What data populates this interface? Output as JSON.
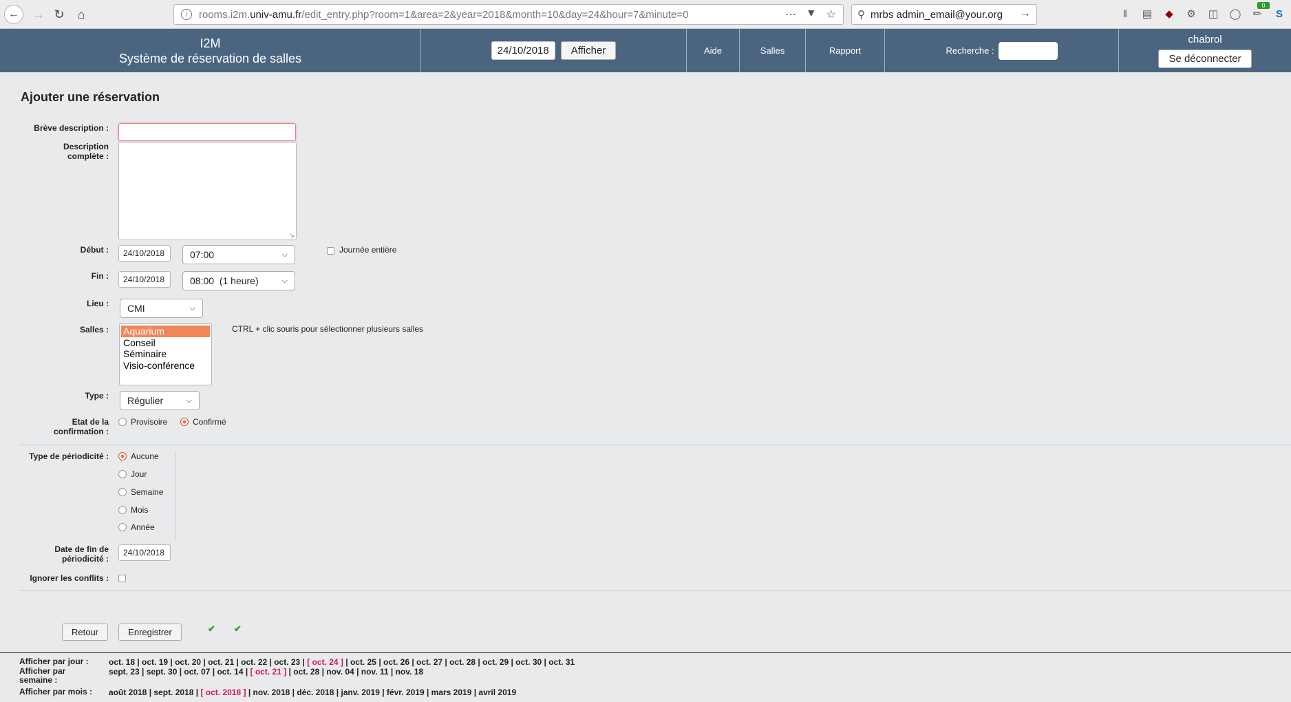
{
  "browser": {
    "url_prefix": "rooms.i2m.",
    "url_host": "univ-amu.fr",
    "url_path": "/edit_entry.php?room=1&area=2&year=2018&month=10&day=24&hour=7&minute=0",
    "search_text": "mrbs admin_email@your.org",
    "notification_badge": "0"
  },
  "header": {
    "org": "I2M",
    "system": "Système de réservation de salles",
    "date_value": "24/10/2018",
    "afficher_label": "Afficher",
    "nav": [
      "Aide",
      "Salles",
      "Rapport"
    ],
    "search_label": "Recherche :",
    "user": "chabrol",
    "logout_label": "Se déconnecter"
  },
  "form": {
    "title": "Ajouter une réservation",
    "breve_label": "Brève description :",
    "desc_label_1": "Description",
    "desc_label_2": "complète :",
    "debut_label": "Début :",
    "debut_date": "24/10/2018",
    "debut_time": "07:00",
    "journee_label": "Journée entière",
    "fin_label": "Fin :",
    "fin_date": "24/10/2018",
    "fin_time": "08:00  (1 heure)",
    "lieu_label": "Lieu :",
    "lieu_value": "CMI",
    "salles_label": "Salles :",
    "salles_options": [
      "Aquarium",
      "Conseil",
      "Séminaire",
      "Visio-conférence"
    ],
    "salles_selected": "Aquarium",
    "salles_hint": "CTRL + clic souris pour sélectionner plusieurs salles",
    "type_label": "Type :",
    "type_value": "Régulier",
    "etat_label_1": "Etat de la",
    "etat_label_2": "confirmation :",
    "etat_options": [
      "Provisoire",
      "Confirmé"
    ],
    "etat_selected": "Confirmé",
    "periodicite_label": "Type de périodicité :",
    "periodicite_options": [
      "Aucune",
      "Jour",
      "Semaine",
      "Mois",
      "Année"
    ],
    "periodicite_selected": "Aucune",
    "fin_perio_label_1": "Date de fin de",
    "fin_perio_label_2": "périodicité :",
    "fin_perio_value": "24/10/2018",
    "ignorer_label": "Ignorer les conflits :",
    "retour_label": "Retour",
    "enregistrer_label": "Enregistrer",
    "tick": "✔"
  },
  "footer": {
    "jour_label": "Afficher par jour :",
    "jour_links": "oct. 18 | oct. 19 | oct. 20 | oct. 21 | oct. 22 | oct. 23 | ",
    "jour_current": "[ oct. 24 ]",
    "jour_links_after": " | oct. 25 | oct. 26 | oct. 27 | oct. 28 | oct. 29 | oct. 30 | oct. 31",
    "semaine_label_1": "Afficher par",
    "semaine_label_2": "semaine :",
    "semaine_links": "sept. 23 | sept. 30 | oct. 07 | oct. 14 | ",
    "semaine_current": "[ oct. 21 ]",
    "semaine_links_after": " | oct. 28 | nov. 04 | nov. 11 | nov. 18",
    "mois_label": "Afficher par mois :",
    "mois_links": "août 2018 | sept. 2018 | ",
    "mois_current": "[ oct. 2018 ]",
    "mois_links_after": " | nov. 2018 | déc. 2018 | janv. 2019 | févr. 2019 | mars 2019 | avril 2019"
  }
}
